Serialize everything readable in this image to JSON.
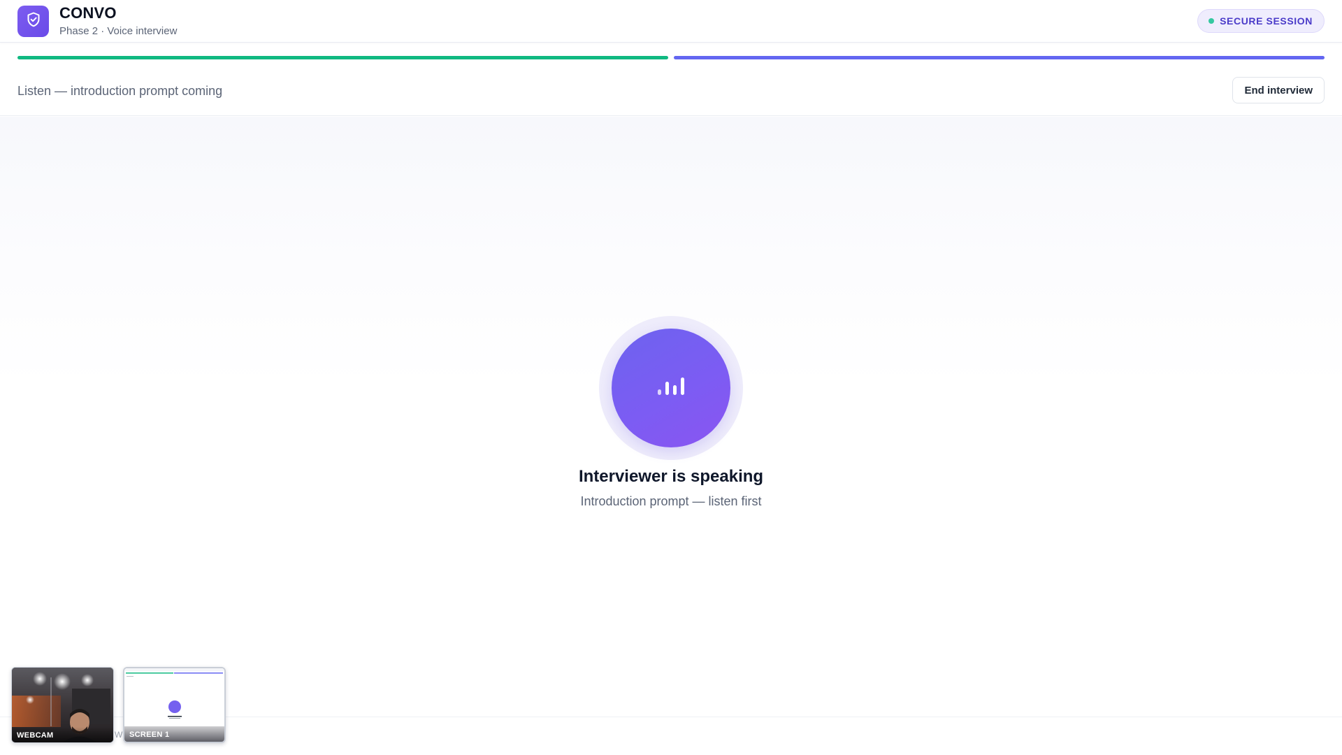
{
  "header": {
    "app_name": "CONVO",
    "subtitle": "Phase 2 · Voice interview",
    "logo_icon": "shield-check-icon",
    "badge_label": "SECURE SESSION"
  },
  "progress": {
    "segments": [
      {
        "name": "phase-1",
        "fill": 1.0,
        "color": "#10b981"
      },
      {
        "name": "phase-2",
        "fill": 1.0,
        "color": "#6366f1"
      }
    ]
  },
  "status_bar": {
    "text": "Listen — introduction prompt coming",
    "end_button_label": "End interview"
  },
  "stage": {
    "orb_icon": "audio-bars-icon",
    "title": "Interviewer is speaking",
    "subtitle": "Introduction prompt — listen first"
  },
  "thumbnails": {
    "webcam_label": "WEBCAM",
    "screen_label": "SCREEN 1",
    "gap_letter": "W"
  },
  "colors": {
    "accent": "#6c5ce7",
    "success": "#10b981",
    "badge_text": "#4a3bc9"
  }
}
